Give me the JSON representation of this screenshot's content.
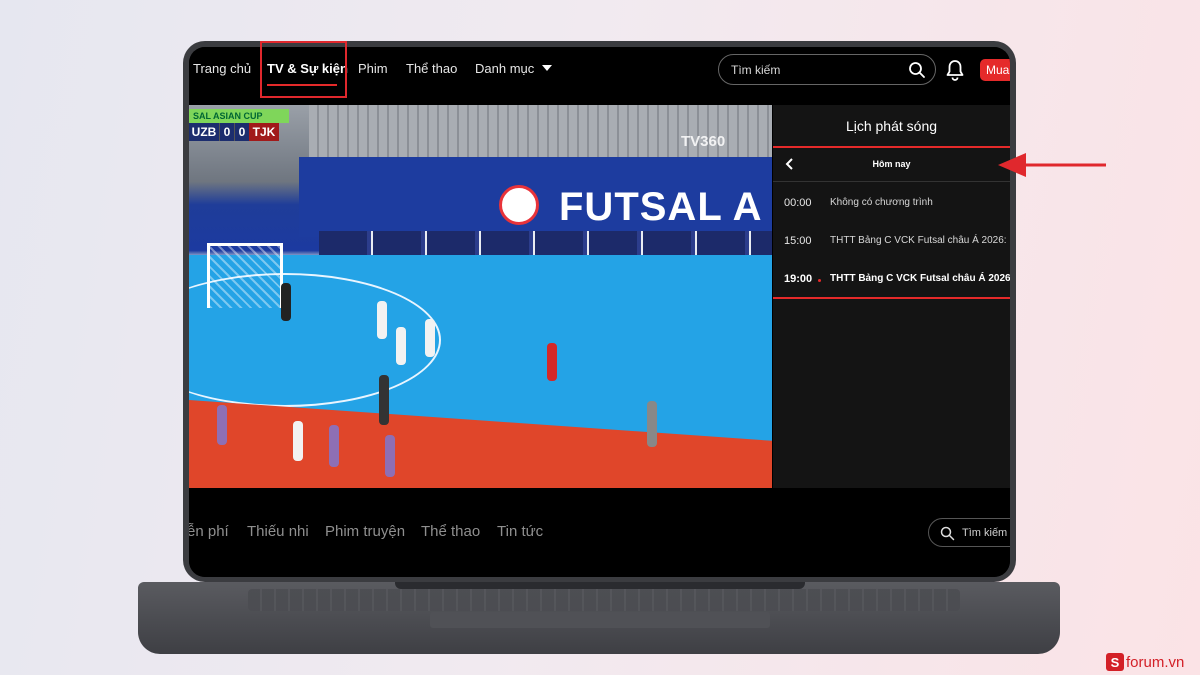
{
  "nav": {
    "items": [
      "Trang chủ",
      "TV & Sự kiện",
      "Phim",
      "Thể thao",
      "Danh mục"
    ],
    "active": "TV & Sự kiện",
    "search_placeholder": "Tìm kiếm",
    "buy_label": "Mua"
  },
  "video": {
    "scoreboard": {
      "tournament": "SAL ASIAN CUP",
      "team_home": "UZB",
      "score_home": "0",
      "score_away": "0",
      "team_away": "TJK"
    },
    "banner_text": "FUTSAL A",
    "watermark": "TV360"
  },
  "schedule": {
    "title": "Lịch phát sóng",
    "day": "Hôm nay",
    "programs": [
      {
        "time": "00:00",
        "title": "Không có chương trình"
      },
      {
        "time": "15:00",
        "title": "THTT Bảng C VCK Futsal châu Á 2026:"
      },
      {
        "time": "19:00",
        "title": "THTT Bảng C VCK Futsal châu Á 2026"
      }
    ],
    "current_index": 2
  },
  "categories": {
    "items": [
      "ễn phí",
      "Thiếu nhi",
      "Phim truyện",
      "Thể thao",
      "Tin tức"
    ],
    "search_placeholder": "Tìm kiếm k"
  },
  "watermark_brand": {
    "logo": "S",
    "text": "forum.vn"
  },
  "colors": {
    "accent": "#e52a2a",
    "annotation": "#e0282d",
    "panel_bg": "#141414",
    "court": "#24a3e6"
  }
}
